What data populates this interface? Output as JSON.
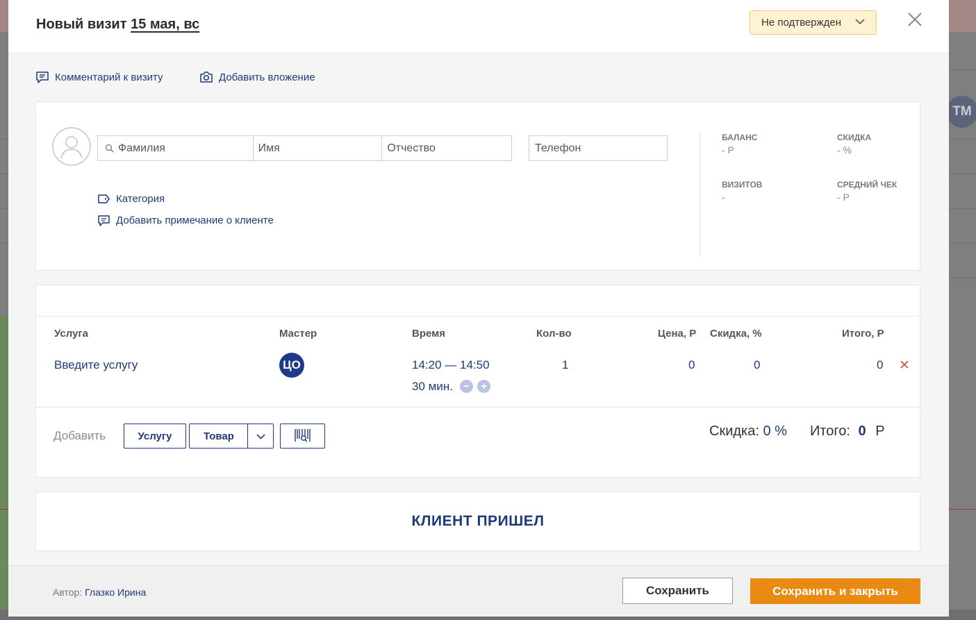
{
  "modal": {
    "title_prefix": "Новый визит",
    "title_date": "15 мая, вс",
    "status": "Не подтвержден",
    "links": {
      "comment": "Комментарий к визиту",
      "attachment": "Добавить вложение"
    }
  },
  "client": {
    "placeholders": {
      "last_name": "Фамилия",
      "first_name": "Имя",
      "middle_name": "Отчество",
      "phone": "Телефон"
    },
    "category_link": "Категория",
    "note_link": "Добавить примечание о клиенте",
    "stats": {
      "balance_label": "БАЛАНС",
      "balance_value": "- Р",
      "discount_label": "СКИДКА",
      "discount_value": "- %",
      "visits_label": "ВИЗИТОВ",
      "visits_value": "-",
      "avg_check_label": "СРЕДНИЙ ЧЕК",
      "avg_check_value": "- Р"
    }
  },
  "services": {
    "headers": {
      "service": "Услуга",
      "master": "Мастер",
      "time": "Время",
      "qty": "Кол-во",
      "price": "Цена, Р",
      "discount": "Скидка, %",
      "total": "Итого, Р"
    },
    "row": {
      "service": "Введите услугу",
      "master_initials": "ЦО",
      "time_range": "14:20 — 14:50",
      "duration": "30 мин.",
      "qty": "1",
      "price": "0",
      "discount": "0",
      "total": "0"
    },
    "add_label": "Добавить",
    "btn_service": "Услугу",
    "btn_product": "Товар",
    "summary": {
      "discount_label": "Скидка:",
      "discount_value": "0 %",
      "total_label": "Итого:",
      "total_value": "0",
      "currency": "Р"
    }
  },
  "arrived_button": "КЛИЕНТ ПРИШЕЛ",
  "footer": {
    "author_label": "Автор:",
    "author_name": "Глазко Ирина",
    "save": "Сохранить",
    "save_close": "Сохранить и закрыть"
  },
  "background": {
    "avatar_initials": "ТМ"
  },
  "colors": {
    "accent_blue": "#1f3a78",
    "orange": "#e98a12",
    "status_bg": "#fdf3d3",
    "delete_red": "#d9534f"
  }
}
